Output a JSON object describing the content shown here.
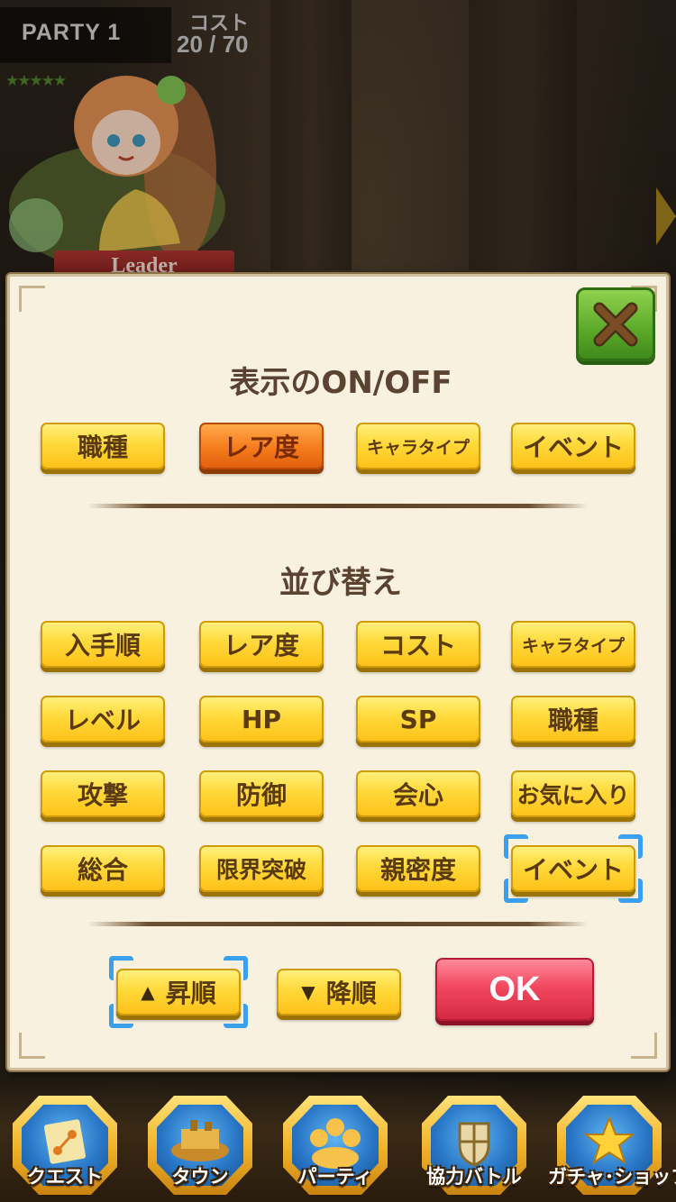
{
  "header": {
    "party_label": "PARTY 1",
    "cost_title": "コスト",
    "cost_value": "20 / 70",
    "rarity_stars": "★★★★★",
    "leader_tag": "Leader"
  },
  "dialog": {
    "display_title": "表示のON/OFF",
    "display_buttons": [
      {
        "label": "職種",
        "active": false
      },
      {
        "label": "レア度",
        "active": true
      },
      {
        "label": "キャラタイプ",
        "active": false
      },
      {
        "label": "イベント",
        "active": false
      }
    ],
    "sort_title": "並び替え",
    "sort_buttons": [
      {
        "label": "入手順"
      },
      {
        "label": "レア度"
      },
      {
        "label": "コスト"
      },
      {
        "label": "キャラタイプ"
      },
      {
        "label": "レベル"
      },
      {
        "label": "HP"
      },
      {
        "label": "SP"
      },
      {
        "label": "職種"
      },
      {
        "label": "攻撃"
      },
      {
        "label": "防御"
      },
      {
        "label": "会心"
      },
      {
        "label": "お気に入り"
      },
      {
        "label": "総合"
      },
      {
        "label": "限界突破"
      },
      {
        "label": "親密度"
      },
      {
        "label": "イベント",
        "selected": true
      }
    ],
    "ascending": {
      "label": "昇順",
      "icon": "▲",
      "selected": true
    },
    "descending": {
      "label": "降順",
      "icon": "▼"
    },
    "ok_label": "OK",
    "close_icon": "close-x-icon"
  },
  "bottom_nav": [
    {
      "label": "クエスト",
      "icon": "quest-map-icon"
    },
    {
      "label": "タウン",
      "icon": "town-icon"
    },
    {
      "label": "パーティ",
      "icon": "party-icon"
    },
    {
      "label": "協力バトル",
      "icon": "coop-battle-icon"
    },
    {
      "label": "ガチャ･ショップ",
      "icon": "gacha-star-icon"
    }
  ],
  "colors": {
    "dialog_bg": "#f8f1e0",
    "yellow_button": "#ffd93a",
    "orange_button": "#f57c1c",
    "ok_button": "#f2485f",
    "close_button": "#5aa828",
    "selection_frame": "#3aa0ee",
    "title_text": "#5a4330"
  }
}
